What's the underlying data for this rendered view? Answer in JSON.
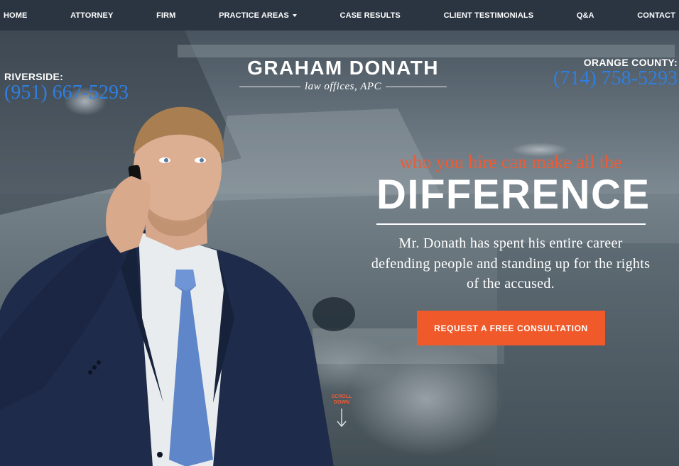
{
  "nav": {
    "items": [
      {
        "label": "HOME"
      },
      {
        "label": "ATTORNEY"
      },
      {
        "label": "FIRM"
      },
      {
        "label": "PRACTICE AREAS",
        "has_dropdown": true
      },
      {
        "label": "CASE RESULTS"
      },
      {
        "label": "CLIENT TESTIMONIALS"
      },
      {
        "label": "Q&A"
      },
      {
        "label": "CONTACT"
      }
    ],
    "caret_icon": "chevron-down-icon"
  },
  "header": {
    "left_phone": {
      "label": "RIVERSIDE:",
      "number": "(951) 667-5293"
    },
    "right_phone": {
      "label": "ORANGE COUNTY:",
      "number": "(714) 758-5293"
    },
    "logo": {
      "name": "GRAHAM DONATH",
      "subtitle": "law offices, APC"
    }
  },
  "hero": {
    "tagline": "who you hire can make all the",
    "headline": "DIFFERENCE",
    "description": "Mr. Donath has spent his entire career defending people and standing up for the rights of the accused.",
    "cta_label": "REQUEST A FREE CONSULTATION",
    "scroll_label_1": "SCROLL",
    "scroll_label_2": "DOWN",
    "scroll_icon": "arrow-down-icon"
  },
  "colors": {
    "nav_bg": "#2b3542",
    "accent": "#f05a2b",
    "phone_blue": "#2f7fe0"
  }
}
